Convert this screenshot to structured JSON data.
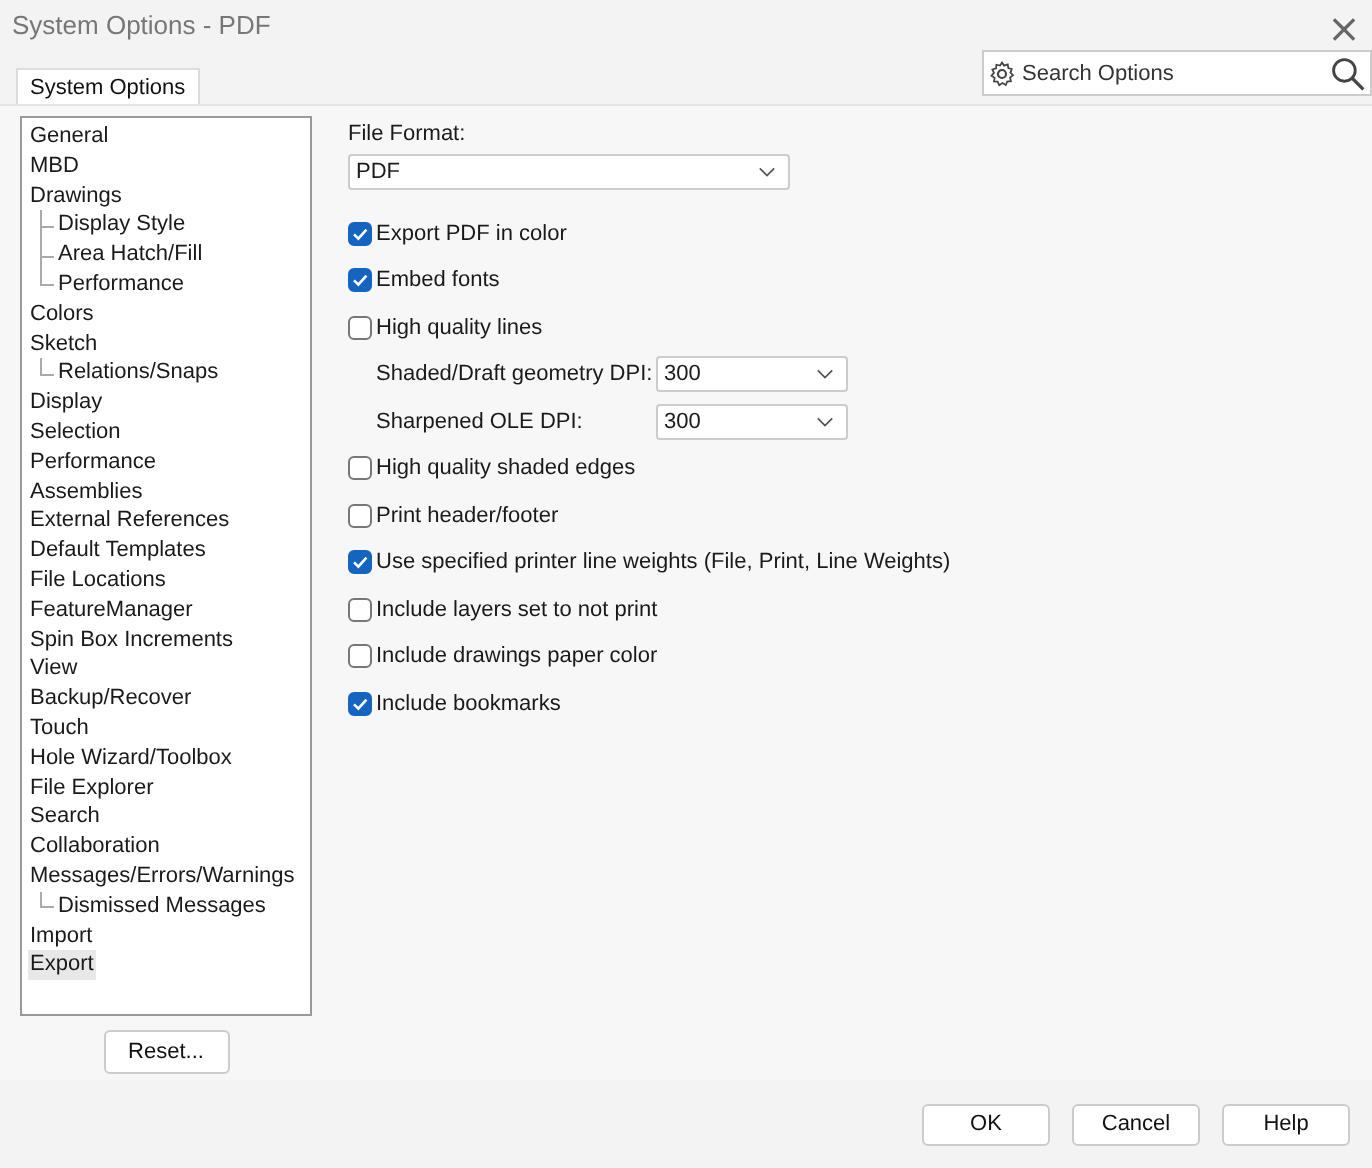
{
  "window": {
    "title": "System Options - PDF",
    "close": "×"
  },
  "tabs": [
    {
      "label": "System Options",
      "selected": true
    }
  ],
  "search": {
    "placeholder": "Search Options"
  },
  "sidebar": {
    "items": [
      {
        "label": "General",
        "selected": false
      },
      {
        "label": "MBD",
        "selected": false
      },
      {
        "label": "Drawings",
        "selected": false,
        "children": [
          {
            "label": "Display Style",
            "selected": false
          },
          {
            "label": "Area Hatch/Fill",
            "selected": false
          },
          {
            "label": "Performance",
            "selected": false
          }
        ]
      },
      {
        "label": "Colors",
        "selected": false
      },
      {
        "label": "Sketch",
        "selected": false,
        "children": [
          {
            "label": "Relations/Snaps",
            "selected": false
          }
        ]
      },
      {
        "label": "Display",
        "selected": false
      },
      {
        "label": "Selection",
        "selected": false
      },
      {
        "label": "Performance",
        "selected": false
      },
      {
        "label": "Assemblies",
        "selected": false
      },
      {
        "label": "External References",
        "selected": false
      },
      {
        "label": "Default Templates",
        "selected": false
      },
      {
        "label": "File Locations",
        "selected": false
      },
      {
        "label": "FeatureManager",
        "selected": false
      },
      {
        "label": "Spin Box Increments",
        "selected": false
      },
      {
        "label": "View",
        "selected": false
      },
      {
        "label": "Backup/Recover",
        "selected": false
      },
      {
        "label": "Touch",
        "selected": false
      },
      {
        "label": "Hole Wizard/Toolbox",
        "selected": false
      },
      {
        "label": "File Explorer",
        "selected": false
      },
      {
        "label": "Search",
        "selected": false
      },
      {
        "label": "Collaboration",
        "selected": false
      },
      {
        "label": "Messages/Errors/Warnings",
        "selected": false,
        "children": [
          {
            "label": "Dismissed Messages",
            "selected": false
          }
        ]
      },
      {
        "label": "Import",
        "selected": false
      },
      {
        "label": "Export",
        "selected": true
      }
    ],
    "reset": "Reset..."
  },
  "file_format": {
    "label": "File Format:",
    "value": "PDF"
  },
  "options": [
    {
      "kind": "checkbox",
      "label": "Export PDF in color",
      "checked": true
    },
    {
      "kind": "checkbox",
      "label": "Embed fonts",
      "checked": true
    },
    {
      "kind": "checkbox",
      "label": "High quality lines",
      "checked": false
    },
    {
      "kind": "select",
      "label": "Shaded/Draft geometry DPI:",
      "value": "300"
    },
    {
      "kind": "select",
      "label": "Sharpened OLE DPI:",
      "value": "300"
    },
    {
      "kind": "checkbox",
      "label": "High quality shaded edges",
      "checked": false
    },
    {
      "kind": "checkbox",
      "label": "Print header/footer",
      "checked": false
    },
    {
      "kind": "checkbox",
      "label": "Use specified printer line weights (File, Print, Line Weights)",
      "checked": true
    },
    {
      "kind": "checkbox",
      "label": "Include layers set to not print",
      "checked": false
    },
    {
      "kind": "checkbox",
      "label": "Include drawings paper color",
      "checked": false
    },
    {
      "kind": "checkbox",
      "label": "Include bookmarks",
      "checked": true
    }
  ],
  "buttons": [
    "OK",
    "Cancel",
    "Help"
  ]
}
